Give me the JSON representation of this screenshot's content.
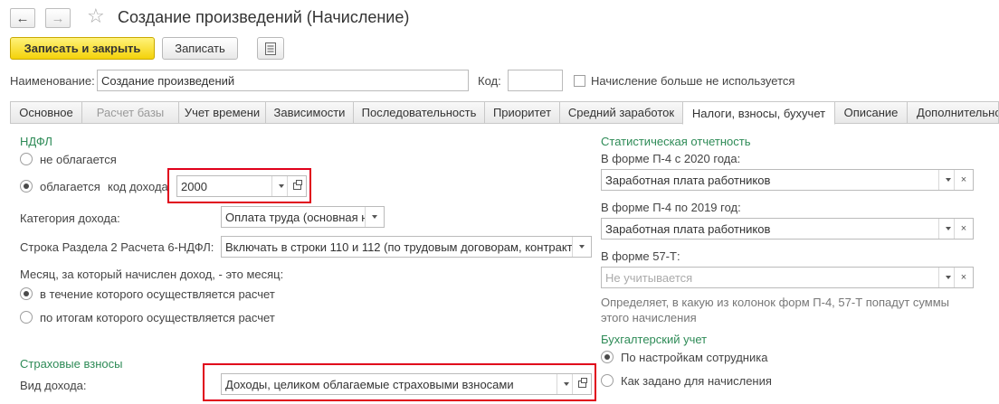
{
  "window": {
    "title": "Создание произведений (Начисление)"
  },
  "toolbar": {
    "save_close_label": "Записать и закрыть",
    "save_label": "Записать"
  },
  "header": {
    "name_label": "Наименование:",
    "name_value": "Создание произведений",
    "code_label": "Код:",
    "code_value": "",
    "not_used_label": "Начисление больше не используется"
  },
  "tabs": [
    {
      "label": "Основное"
    },
    {
      "label": "Расчет базы"
    },
    {
      "label": "Учет времени"
    },
    {
      "label": "Зависимости"
    },
    {
      "label": "Последовательность"
    },
    {
      "label": "Приоритет"
    },
    {
      "label": "Средний заработок"
    },
    {
      "label": "Налоги, взносы, бухучет"
    },
    {
      "label": "Описание"
    },
    {
      "label": "Дополнительно"
    }
  ],
  "ndfl": {
    "heading": "НДФЛ",
    "not_taxed_label": "не облагается",
    "taxed_label": "облагается",
    "income_code_label": "код дохода",
    "income_code_value": "2000",
    "category_label": "Категория дохода:",
    "category_value": "Оплата труда (основная н",
    "row_label": "Строка Раздела 2 Расчета 6-НДФЛ:",
    "row_value": "Включать в строки 110 и 112 (по трудовым договорам, контракт",
    "month_label": "Месяц, за который начислен доход, - это месяц:",
    "month_option1": "в течение которого осуществляется расчет",
    "month_option2": "по итогам которого осуществляется расчет"
  },
  "insurance": {
    "heading": "Страховые взносы",
    "income_type_label": "Вид дохода:",
    "income_type_value": "Доходы, целиком облагаемые страховыми взносами"
  },
  "stats": {
    "heading": "Статистическая отчетность",
    "p4_2020_label": "В форме П-4 с 2020 года:",
    "p4_2020_value": "Заработная плата работников",
    "p4_2019_label": "В форме П-4 по 2019 год:",
    "p4_2019_value": "Заработная плата работников",
    "f57t_label": "В форме 57-Т:",
    "f57t_placeholder": "Не учитывается",
    "note_line1": "Определяет, в какую из колонок форм П-4, 57-Т попадут суммы",
    "note_line2": "этого начисления"
  },
  "accounting": {
    "heading": "Бухгалтерский учет",
    "option1": "По настройкам сотрудника",
    "option2": "Как задано для начисления"
  },
  "colors": {
    "green_heading": "#2e8b57",
    "highlight_border": "#e0001b",
    "primary_button": "#f4d20a"
  }
}
